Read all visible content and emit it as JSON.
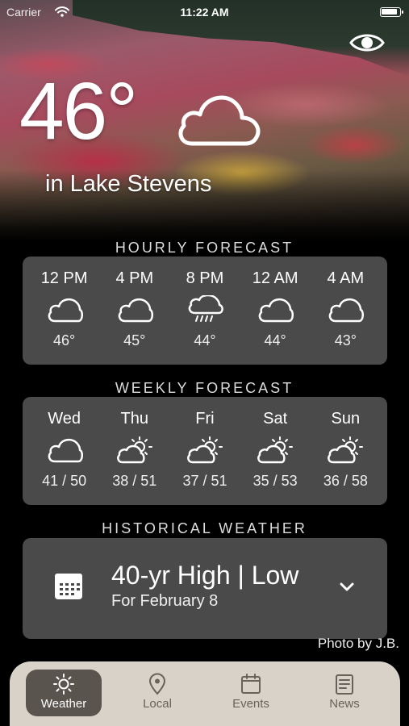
{
  "status_bar": {
    "carrier": "Carrier",
    "time": "11:22 AM",
    "battery_level": 0.9
  },
  "current": {
    "temperature": "46°",
    "location": "in Lake Stevens",
    "condition_icon": "cloud-icon"
  },
  "hourly": {
    "title": "HOURLY FORECAST",
    "items": [
      {
        "time": "12 PM",
        "icon": "cloud-icon",
        "temp": "46°"
      },
      {
        "time": "4 PM",
        "icon": "cloud-icon",
        "temp": "45°"
      },
      {
        "time": "8 PM",
        "icon": "rain-icon",
        "temp": "44°"
      },
      {
        "time": "12 AM",
        "icon": "cloud-icon",
        "temp": "44°"
      },
      {
        "time": "4 AM",
        "icon": "cloud-icon",
        "temp": "43°"
      }
    ]
  },
  "weekly": {
    "title": "WEEKLY FORECAST",
    "items": [
      {
        "day": "Wed",
        "icon": "cloud-icon",
        "range": "41 / 50"
      },
      {
        "day": "Thu",
        "icon": "partly-sunny-icon",
        "range": "38 / 51"
      },
      {
        "day": "Fri",
        "icon": "partly-sunny-icon",
        "range": "37 / 51"
      },
      {
        "day": "Sat",
        "icon": "partly-sunny-icon",
        "range": "35 / 53"
      },
      {
        "day": "Sun",
        "icon": "partly-sunny-icon",
        "range": "36 / 58"
      }
    ]
  },
  "historical": {
    "title": "HISTORICAL WEATHER",
    "heading": "40-yr High | Low",
    "subtitle": "For February 8"
  },
  "photo_credit": "Photo by J.B.",
  "tabs": [
    {
      "label": "Weather",
      "icon": "sun-icon",
      "active": true
    },
    {
      "label": "Local",
      "icon": "location-pin-icon",
      "active": false
    },
    {
      "label": "Events",
      "icon": "calendar-icon",
      "active": false
    },
    {
      "label": "News",
      "icon": "news-icon",
      "active": false
    }
  ]
}
